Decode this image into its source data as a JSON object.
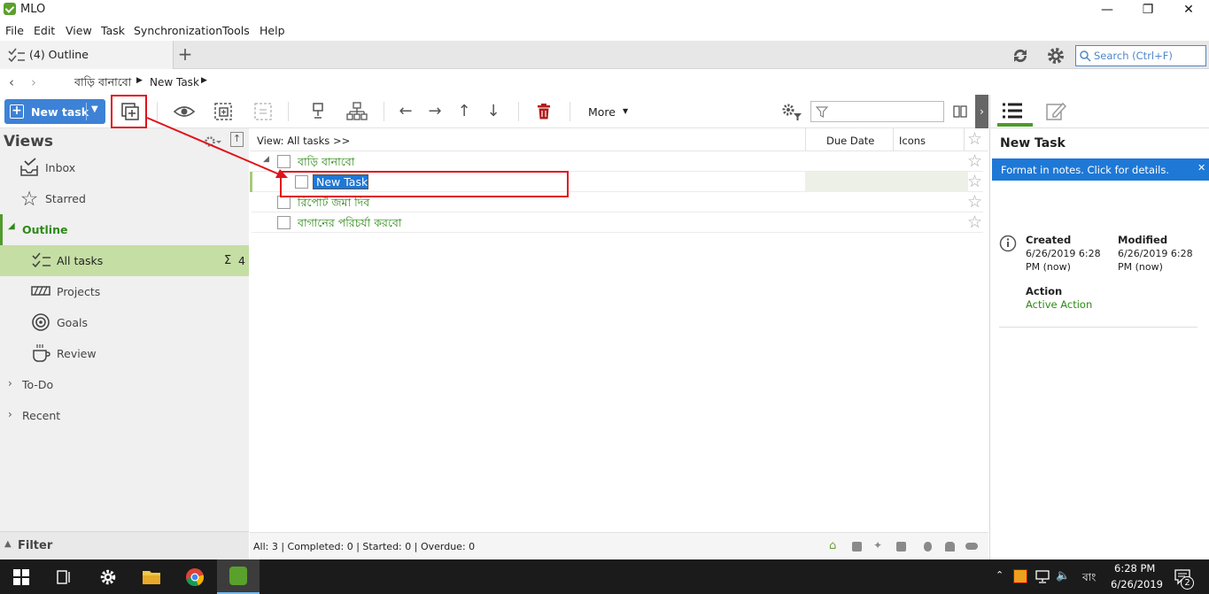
{
  "window": {
    "title": "MLO"
  },
  "menu": [
    "File",
    "Edit",
    "View",
    "Task",
    "Synchronization",
    "Tools",
    "Help"
  ],
  "tab": {
    "label": "(4) Outline"
  },
  "search": {
    "placeholder": "Search (Ctrl+F)"
  },
  "breadcrumb": {
    "parent": "বাড়ি বানাবো",
    "current": "New Task"
  },
  "toolbar": {
    "new_task": "New task",
    "more": "More"
  },
  "sidebar": {
    "header": "Views",
    "items": [
      {
        "label": "Inbox",
        "icon": "inbox-icon"
      },
      {
        "label": "Starred",
        "icon": "star-icon"
      },
      {
        "label": "Outline",
        "icon": "collapse-icon"
      },
      {
        "label": "All tasks",
        "icon": "checklist-icon",
        "count": "4"
      },
      {
        "label": "Projects",
        "icon": "projects-icon"
      },
      {
        "label": "Goals",
        "icon": "target-icon"
      },
      {
        "label": "Review",
        "icon": "coffee-icon"
      },
      {
        "label": "To-Do",
        "icon": "expand-icon"
      },
      {
        "label": "Recent",
        "icon": "expand-icon"
      }
    ],
    "sum_symbol": "Σ",
    "filter": "Filter"
  },
  "main": {
    "view_label": "View: All tasks >>",
    "columns": [
      "Due Date",
      "Icons"
    ],
    "tasks": [
      {
        "title": "বাড়ি বানাবো"
      },
      {
        "title": "New Task"
      },
      {
        "title": "রিপোর্ট জমা দিব"
      },
      {
        "title": "বাগানের পরিচর্যা করবো"
      }
    ],
    "status": "All: 3 | Completed: 0 | Started: 0 | Overdue: 0"
  },
  "right_panel": {
    "title": "New Task",
    "notice": "Format in notes. Click  for details.",
    "created_label": "Created",
    "created_value": "6/26/2019 6:28 PM (now)",
    "modified_label": "Modified",
    "modified_value": "6/26/2019 6:28 PM (now)",
    "action_label": "Action",
    "action_value": "Active Action"
  },
  "taskbar": {
    "time": "6:28 PM",
    "date": "6/26/2019",
    "lang": "বাং",
    "notifications": "2"
  },
  "colors": {
    "accent_green": "#2d8a16",
    "selection_blue": "#1e78d6",
    "annotation_red": "#e0121b",
    "sidebar_selected": "#c5dea4"
  }
}
